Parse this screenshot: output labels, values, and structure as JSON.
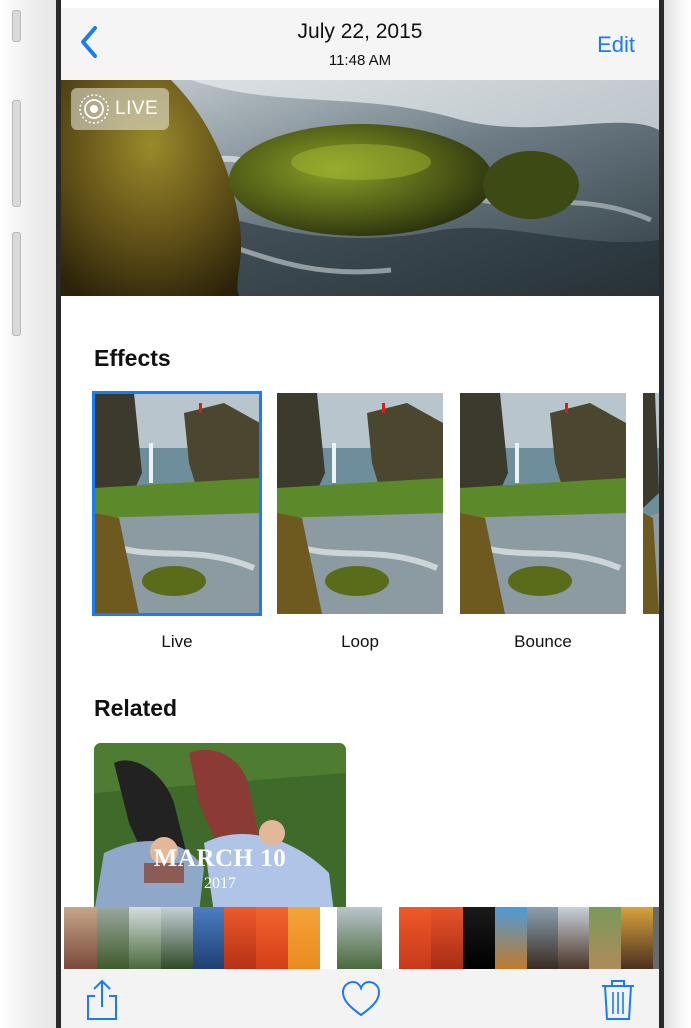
{
  "nav": {
    "back_icon": "chevron-left-icon",
    "title": "July 22, 2015",
    "subtitle": "11:48 AM",
    "edit_label": "Edit"
  },
  "hero": {
    "live_label": "LIVE",
    "live_icon": "live-photo-icon"
  },
  "effects": {
    "title": "Effects",
    "items": [
      {
        "label": "Live",
        "selected": true
      },
      {
        "label": "Loop",
        "selected": false
      },
      {
        "label": "Bounce",
        "selected": false
      }
    ]
  },
  "related": {
    "title": "Related",
    "card": {
      "date": "MARCH 10",
      "year": "2017"
    }
  },
  "toolbar": {
    "share_icon": "share-icon",
    "favorite_icon": "heart-icon",
    "delete_icon": "trash-icon"
  },
  "colors": {
    "accent": "#1a7cf3",
    "text": "#111111",
    "bar": "#f5f5f5"
  }
}
